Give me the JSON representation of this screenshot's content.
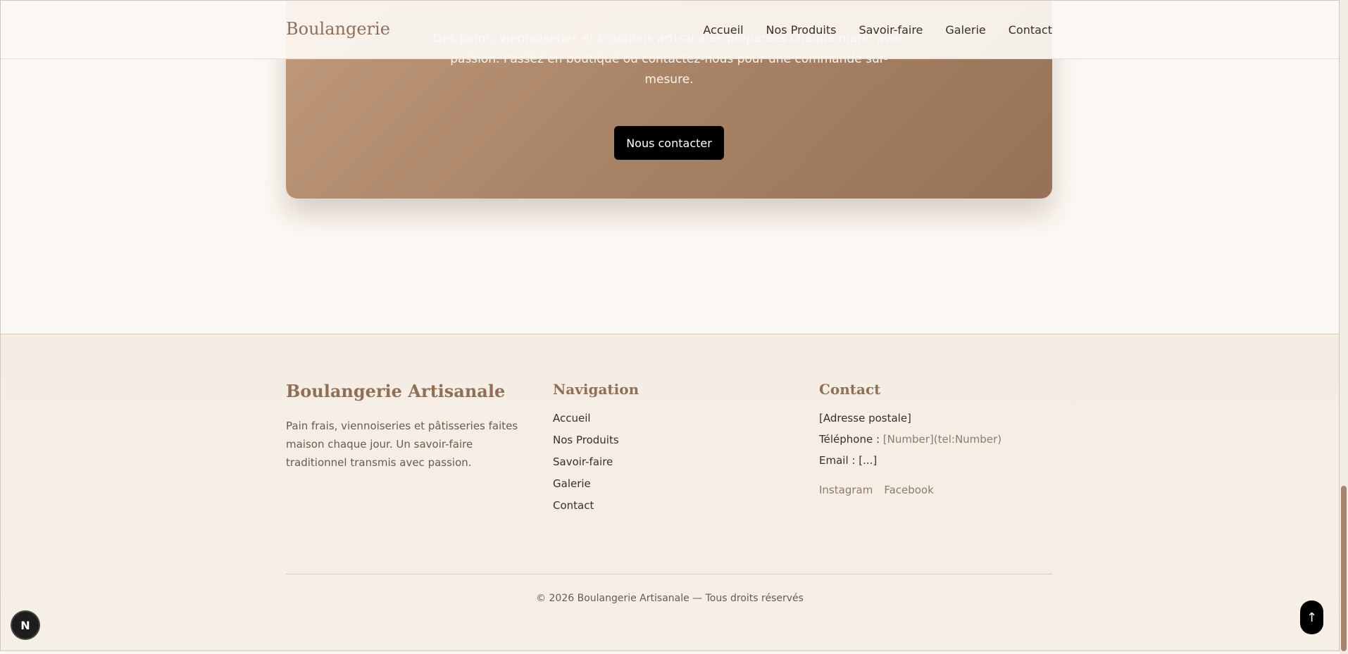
{
  "header": {
    "brand": "Boulangerie",
    "nav": [
      "Accueil",
      "Nos Produits",
      "Savoir-faire",
      "Galerie",
      "Contact"
    ]
  },
  "hero": {
    "text": "Des pains, viennoiseries et créations artisanales préparées chaque matin avec passion. Passez en boutique ou contactez-nous pour une commande sur-mesure.",
    "button": "Nous contacter"
  },
  "footer": {
    "about": {
      "title": "Boulangerie Artisanale",
      "description": "Pain frais, viennoiseries et pâtisseries faites maison chaque jour. Un savoir-faire traditionnel transmis avec passion."
    },
    "navigation": {
      "title": "Navigation",
      "links": [
        "Accueil",
        "Nos Produits",
        "Savoir-faire",
        "Galerie",
        "Contact"
      ]
    },
    "contact": {
      "title": "Contact",
      "address": "[Adresse postale]",
      "phone_label": "Téléphone :",
      "phone_value": "[Number](tel:Number)",
      "email": "Email : [...]",
      "socials": [
        "Instagram",
        "Facebook"
      ]
    },
    "copyright": "© 2026 Boulangerie Artisanale — Tous droits réservés"
  },
  "floating": {
    "badge": "N",
    "back_to_top": "↑"
  }
}
